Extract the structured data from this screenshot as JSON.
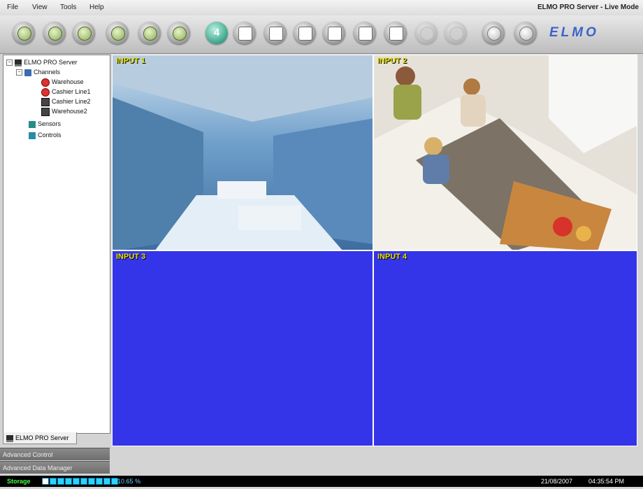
{
  "app_title": "ELMO PRO Server - Live Mode",
  "menu": [
    "File",
    "View",
    "Tools",
    "Help"
  ],
  "toolbar": {
    "layout_active_label": "4",
    "logo_text": "ELMO"
  },
  "tree": {
    "root": "ELMO PRO Server",
    "channels_label": "Channels",
    "channels": [
      "Warehouse",
      "Cashier Line1",
      "Cashier Line2",
      "Warehouse2"
    ],
    "sensors_label": "Sensors",
    "controls_label": "Controls"
  },
  "side_tab": "ELMO PRO Server",
  "panels": [
    "Advanced Control",
    "Advanced Data Manager"
  ],
  "video": {
    "cells": [
      "INPUT 1",
      "INPUT 2",
      "INPUT 3",
      "INPUT 4"
    ]
  },
  "status": {
    "storage_label": "Storage",
    "storage_percent": "10.65 %",
    "storage_fraction": 0.1065,
    "date": "21/08/2007",
    "time": "04:35:54 PM"
  },
  "colors": {
    "empty_cell": "#3434e8",
    "label_yellow": "#e7e300"
  }
}
